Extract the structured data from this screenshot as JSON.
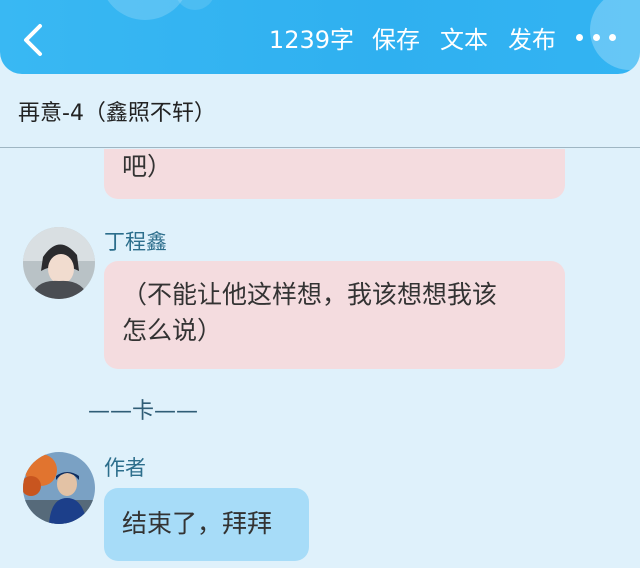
{
  "topbar": {
    "word_count": "1239字",
    "save_label": "保存",
    "text_label": "文本",
    "publish_label": "发布"
  },
  "document": {
    "title": "再意-4（鑫照不轩）"
  },
  "messages": [
    {
      "type": "bubble",
      "text": "吧）"
    },
    {
      "type": "speaker",
      "name": "丁程鑫",
      "text": "（不能让他这样想，我该想想我该怎么说）",
      "line1": "（不能让他这样想，我该想想我该",
      "line2": "怎么说）"
    },
    {
      "type": "divider",
      "text": "——卡——"
    },
    {
      "type": "speaker",
      "name": "作者",
      "text": "结束了，拜拜"
    }
  ],
  "colors": {
    "topbar": "#33b4f3",
    "background": "#dff1fb",
    "pink_bubble": "#f4dcdf",
    "blue_bubble": "#a7dcf8"
  }
}
